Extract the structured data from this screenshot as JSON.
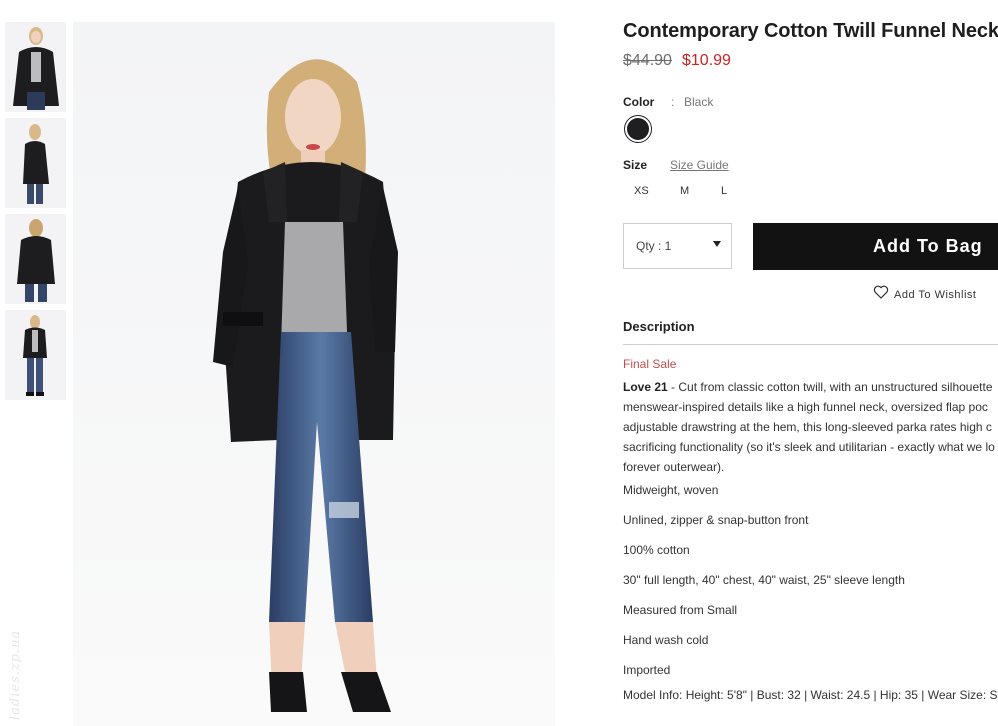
{
  "product": {
    "title": "Contemporary Cotton Twill Funnel Neck",
    "price_original": "$44.90",
    "price_sale": "$10.99",
    "color_label": "Color",
    "color_separator": ":",
    "color_value": "Black",
    "swatch_color": "#1f1f21",
    "size_label": "Size",
    "size_guide": "Size Guide",
    "sizes": [
      "XS",
      "M",
      "L"
    ],
    "qty_label": "Qty : 1",
    "add_to_bag": "Add To Bag",
    "wishlist": "Add To Wishlist"
  },
  "description": {
    "heading": "Description",
    "final_sale": "Final Sale",
    "brand": "Love 21",
    "lines": [
      " - Cut from classic cotton twill, with an unstructured silhouette",
      "menswear-inspired details like a high funnel neck, oversized flap poc",
      "adjustable drawstring at the hem, this long-sleeved parka rates high c",
      "sacrificing functionality (so it's sleek and utilitarian - exactly what we lo",
      "forever outerwear)."
    ],
    "bullets": [
      "Midweight, woven",
      "Unlined, zipper & snap-button front",
      "100% cotton",
      "30\" full length, 40\" chest, 40\" waist, 25\" sleeve length",
      "Measured from Small",
      "Hand wash cold",
      "Imported",
      "Model Info: Height: 5'8\" | Bust: 32 | Waist: 24.5 | Hip: 35 | Wear Size: S"
    ]
  },
  "watermark": "ladies.zp.ua",
  "colors": {
    "sale_red": "#cc2222",
    "final_sale": "#c0504d",
    "button_bg": "#121212"
  }
}
